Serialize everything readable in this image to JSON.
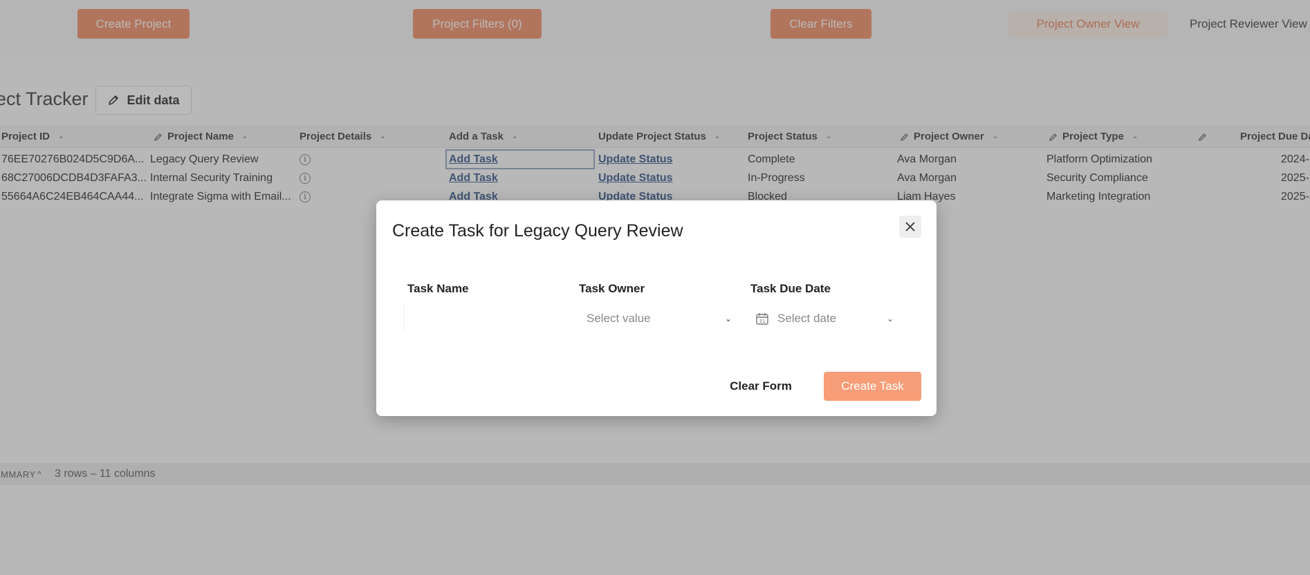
{
  "topbar": {
    "create_project": "Create Project",
    "project_filters": "Project Filters (0)",
    "clear_filters": "Clear Filters",
    "owner_view": "Project Owner View",
    "reviewer_view": "Project Reviewer View"
  },
  "tracker": {
    "title": "Project Tracker",
    "edit_label": "Edit data"
  },
  "table": {
    "columns": [
      "Project ID",
      "Project Name",
      "Project Details",
      "Add a Task",
      "Update Project Status",
      "Project Status",
      "Project Owner",
      "Project Type",
      "",
      "Project Due Date"
    ],
    "rows": [
      {
        "id": "76EE70276B024D5C9D6A...",
        "name": "Legacy Query Review",
        "add_task": "Add Task",
        "update_status": "Update Status",
        "status": "Complete",
        "owner": "Ava Morgan",
        "type": "Platform Optimization",
        "due": "2024-"
      },
      {
        "id": "68C27006DCDB4D3FAFA3...",
        "name": "Internal Security Training",
        "add_task": "Add Task",
        "update_status": "Update Status",
        "status": "In-Progress",
        "owner": "Ava Morgan",
        "type": "Security Compliance",
        "due": "2025-"
      },
      {
        "id": "55664A6C24EB464CAA44...",
        "name": "Integrate Sigma with Email...",
        "add_task": "Add Task",
        "update_status": "Update Status",
        "status": "Blocked",
        "owner": "Liam Hayes",
        "type": "Marketing Integration",
        "due": "2025-"
      }
    ]
  },
  "summary": {
    "label": "SUMMARY",
    "text": "3 rows – 11 columns"
  },
  "modal": {
    "title": "Create Task for Legacy Query Review",
    "task_name_label": "Task Name",
    "task_owner_label": "Task Owner",
    "task_due_label": "Task Due Date",
    "owner_placeholder": "Select value",
    "date_placeholder": "Select date",
    "clear_form": "Clear Form",
    "create_task": "Create Task"
  }
}
